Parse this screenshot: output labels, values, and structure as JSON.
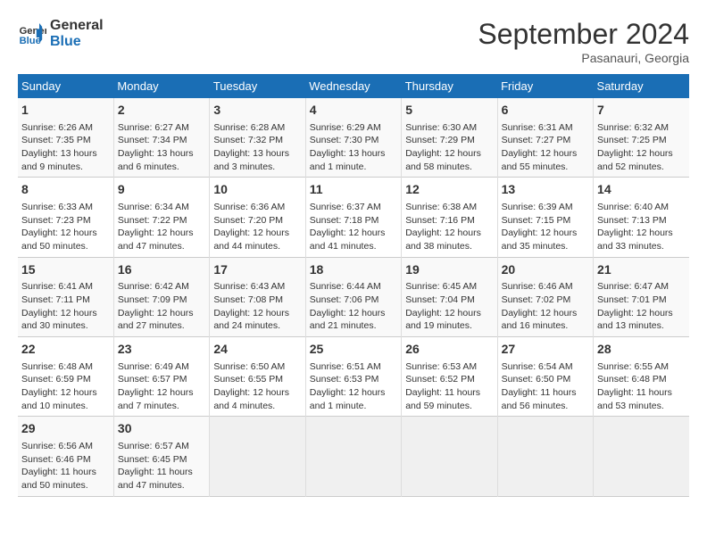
{
  "header": {
    "logo_line1": "General",
    "logo_line2": "Blue",
    "month": "September 2024",
    "location": "Pasanauri, Georgia"
  },
  "columns": [
    "Sunday",
    "Monday",
    "Tuesday",
    "Wednesday",
    "Thursday",
    "Friday",
    "Saturday"
  ],
  "weeks": [
    [
      {
        "day": "1",
        "info": "Sunrise: 6:26 AM\nSunset: 7:35 PM\nDaylight: 13 hours and 9 minutes."
      },
      {
        "day": "2",
        "info": "Sunrise: 6:27 AM\nSunset: 7:34 PM\nDaylight: 13 hours and 6 minutes."
      },
      {
        "day": "3",
        "info": "Sunrise: 6:28 AM\nSunset: 7:32 PM\nDaylight: 13 hours and 3 minutes."
      },
      {
        "day": "4",
        "info": "Sunrise: 6:29 AM\nSunset: 7:30 PM\nDaylight: 13 hours and 1 minute."
      },
      {
        "day": "5",
        "info": "Sunrise: 6:30 AM\nSunset: 7:29 PM\nDaylight: 12 hours and 58 minutes."
      },
      {
        "day": "6",
        "info": "Sunrise: 6:31 AM\nSunset: 7:27 PM\nDaylight: 12 hours and 55 minutes."
      },
      {
        "day": "7",
        "info": "Sunrise: 6:32 AM\nSunset: 7:25 PM\nDaylight: 12 hours and 52 minutes."
      }
    ],
    [
      {
        "day": "8",
        "info": "Sunrise: 6:33 AM\nSunset: 7:23 PM\nDaylight: 12 hours and 50 minutes."
      },
      {
        "day": "9",
        "info": "Sunrise: 6:34 AM\nSunset: 7:22 PM\nDaylight: 12 hours and 47 minutes."
      },
      {
        "day": "10",
        "info": "Sunrise: 6:36 AM\nSunset: 7:20 PM\nDaylight: 12 hours and 44 minutes."
      },
      {
        "day": "11",
        "info": "Sunrise: 6:37 AM\nSunset: 7:18 PM\nDaylight: 12 hours and 41 minutes."
      },
      {
        "day": "12",
        "info": "Sunrise: 6:38 AM\nSunset: 7:16 PM\nDaylight: 12 hours and 38 minutes."
      },
      {
        "day": "13",
        "info": "Sunrise: 6:39 AM\nSunset: 7:15 PM\nDaylight: 12 hours and 35 minutes."
      },
      {
        "day": "14",
        "info": "Sunrise: 6:40 AM\nSunset: 7:13 PM\nDaylight: 12 hours and 33 minutes."
      }
    ],
    [
      {
        "day": "15",
        "info": "Sunrise: 6:41 AM\nSunset: 7:11 PM\nDaylight: 12 hours and 30 minutes."
      },
      {
        "day": "16",
        "info": "Sunrise: 6:42 AM\nSunset: 7:09 PM\nDaylight: 12 hours and 27 minutes."
      },
      {
        "day": "17",
        "info": "Sunrise: 6:43 AM\nSunset: 7:08 PM\nDaylight: 12 hours and 24 minutes."
      },
      {
        "day": "18",
        "info": "Sunrise: 6:44 AM\nSunset: 7:06 PM\nDaylight: 12 hours and 21 minutes."
      },
      {
        "day": "19",
        "info": "Sunrise: 6:45 AM\nSunset: 7:04 PM\nDaylight: 12 hours and 19 minutes."
      },
      {
        "day": "20",
        "info": "Sunrise: 6:46 AM\nSunset: 7:02 PM\nDaylight: 12 hours and 16 minutes."
      },
      {
        "day": "21",
        "info": "Sunrise: 6:47 AM\nSunset: 7:01 PM\nDaylight: 12 hours and 13 minutes."
      }
    ],
    [
      {
        "day": "22",
        "info": "Sunrise: 6:48 AM\nSunset: 6:59 PM\nDaylight: 12 hours and 10 minutes."
      },
      {
        "day": "23",
        "info": "Sunrise: 6:49 AM\nSunset: 6:57 PM\nDaylight: 12 hours and 7 minutes."
      },
      {
        "day": "24",
        "info": "Sunrise: 6:50 AM\nSunset: 6:55 PM\nDaylight: 12 hours and 4 minutes."
      },
      {
        "day": "25",
        "info": "Sunrise: 6:51 AM\nSunset: 6:53 PM\nDaylight: 12 hours and 1 minute."
      },
      {
        "day": "26",
        "info": "Sunrise: 6:53 AM\nSunset: 6:52 PM\nDaylight: 11 hours and 59 minutes."
      },
      {
        "day": "27",
        "info": "Sunrise: 6:54 AM\nSunset: 6:50 PM\nDaylight: 11 hours and 56 minutes."
      },
      {
        "day": "28",
        "info": "Sunrise: 6:55 AM\nSunset: 6:48 PM\nDaylight: 11 hours and 53 minutes."
      }
    ],
    [
      {
        "day": "29",
        "info": "Sunrise: 6:56 AM\nSunset: 6:46 PM\nDaylight: 11 hours and 50 minutes."
      },
      {
        "day": "30",
        "info": "Sunrise: 6:57 AM\nSunset: 6:45 PM\nDaylight: 11 hours and 47 minutes."
      },
      {
        "day": "",
        "info": ""
      },
      {
        "day": "",
        "info": ""
      },
      {
        "day": "",
        "info": ""
      },
      {
        "day": "",
        "info": ""
      },
      {
        "day": "",
        "info": ""
      }
    ]
  ]
}
